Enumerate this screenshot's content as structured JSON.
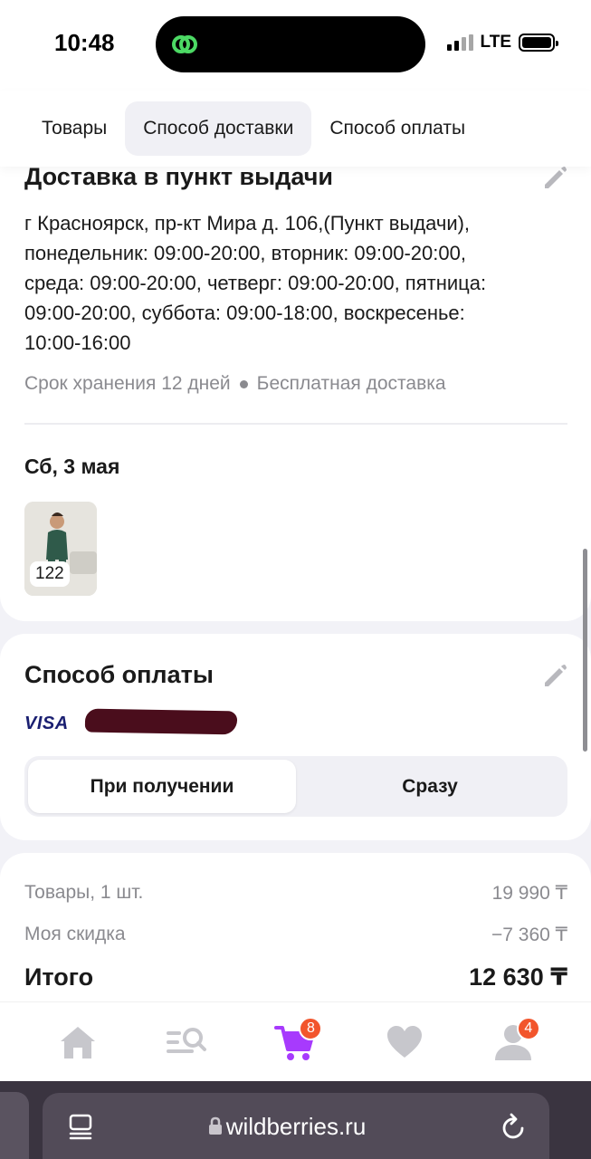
{
  "status_bar": {
    "time": "10:48",
    "network": "LTE"
  },
  "tabs": [
    {
      "label": "Товары",
      "active": false
    },
    {
      "label": "Способ доставки",
      "active": true
    },
    {
      "label": "Способ оплаты",
      "active": false
    }
  ],
  "delivery": {
    "title": "Доставка в пункт выдачи",
    "address_lines": [
      "г Красноярск, пр-кт Мира д. 106,(Пункт выдачи),",
      "понедельник: 09:00-20:00, вторник: 09:00-20:00,",
      "среда: 09:00-20:00, четверг: 09:00-20:00, пятница:",
      "09:00-20:00, суббота: 09:00-18:00, воскресенье:",
      "10:00-16:00"
    ],
    "storage": "Срок хранения 12 дней",
    "shipping": "Бесплатная доставка",
    "date": "Сб, 3 мая",
    "item_size": "122"
  },
  "payment": {
    "title": "Способ оплаты",
    "card_brand": "VISA",
    "options": [
      "При получении",
      "Сразу"
    ],
    "selected_option": "При получении"
  },
  "summary": {
    "goods_label": "Товары, 1 шт.",
    "goods_value": "19 990 ₸",
    "discount_label": "Моя скидка",
    "discount_value": "−7 360 ₸",
    "total_label": "Итого",
    "total_value": "12 630 ₸"
  },
  "bottom_nav": {
    "items": [
      "home-icon",
      "catalog-search-icon",
      "cart-icon",
      "favorites-icon",
      "profile-icon"
    ],
    "cart_badge": "8",
    "profile_badge": "4",
    "active_color": "#a73afd"
  },
  "browser": {
    "url": "wildberries.ru"
  },
  "colors": {
    "accent": "#a73afd",
    "badge": "#f2552c",
    "muted": "#8a8a8f"
  }
}
